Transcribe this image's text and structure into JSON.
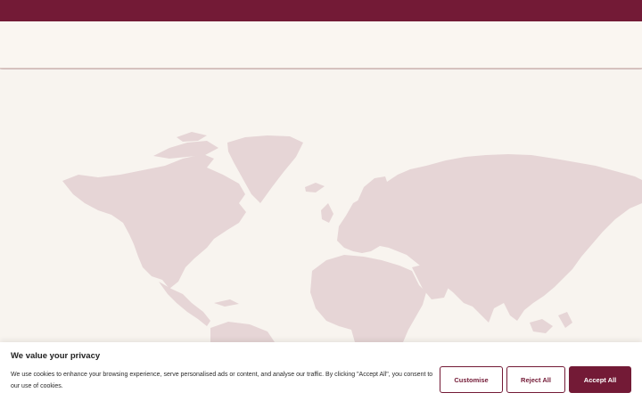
{
  "hero": {
    "heading": ""
  },
  "cookie_banner": {
    "title": "We value your privacy",
    "text": "We use cookies to enhance your browsing experience, serve personalised ads or content, and analyse our traffic. By clicking \"Accept All\", you consent to our use of cookies.",
    "buttons": {
      "customise": "Customise",
      "reject": "Reject All",
      "accept": "Accept All"
    }
  },
  "colors": {
    "brand": "#731a36",
    "background": "#f8f4ef",
    "map_land": "#e6d5d6"
  }
}
